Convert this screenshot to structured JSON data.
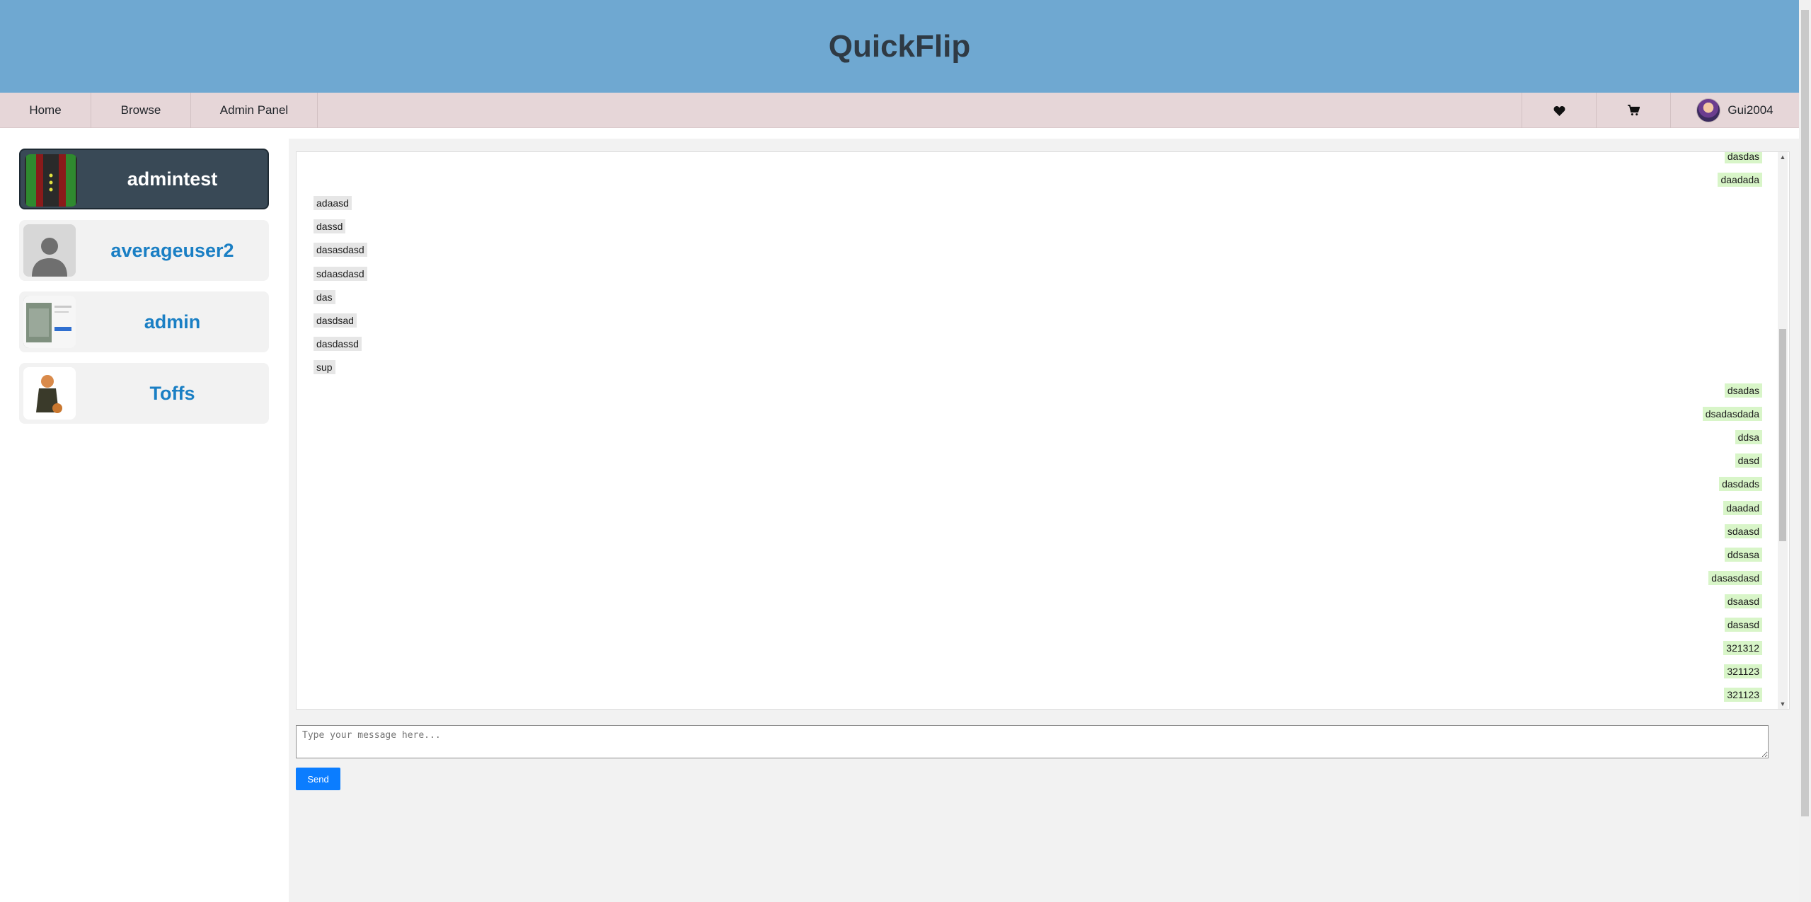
{
  "app": {
    "title": "QuickFlip"
  },
  "nav": {
    "home": "Home",
    "browse": "Browse",
    "admin_panel": "Admin Panel",
    "user_name": "Gui2004"
  },
  "contacts": [
    {
      "name": "admintest",
      "active": true
    },
    {
      "name": "averageuser2",
      "active": false
    },
    {
      "name": "admin",
      "active": false
    },
    {
      "name": "Toffs",
      "active": false
    }
  ],
  "messages": [
    {
      "text": "dasdas",
      "side": "sent"
    },
    {
      "text": "daadada",
      "side": "sent"
    },
    {
      "text": "adaasd",
      "side": "received"
    },
    {
      "text": "dassd",
      "side": "received"
    },
    {
      "text": "dasasdasd",
      "side": "received"
    },
    {
      "text": "sdaasdasd",
      "side": "received"
    },
    {
      "text": "das",
      "side": "received"
    },
    {
      "text": "dasdsad",
      "side": "received"
    },
    {
      "text": "dasdassd",
      "side": "received"
    },
    {
      "text": "sup",
      "side": "received"
    },
    {
      "text": "dsadas",
      "side": "sent"
    },
    {
      "text": "dsadasdada",
      "side": "sent"
    },
    {
      "text": "ddsa",
      "side": "sent"
    },
    {
      "text": "dasd",
      "side": "sent"
    },
    {
      "text": "dasdads",
      "side": "sent"
    },
    {
      "text": "daadad",
      "side": "sent"
    },
    {
      "text": "sdaasd",
      "side": "sent"
    },
    {
      "text": "ddsasa",
      "side": "sent"
    },
    {
      "text": "dasasdasd",
      "side": "sent"
    },
    {
      "text": "dsaasd",
      "side": "sent"
    },
    {
      "text": "dasasd",
      "side": "sent"
    },
    {
      "text": "321312",
      "side": "sent"
    },
    {
      "text": "321123",
      "side": "sent"
    },
    {
      "text": "321123",
      "side": "sent"
    }
  ],
  "composer": {
    "placeholder": "Type your message here...",
    "send_label": "Send"
  },
  "colors": {
    "header": "#6fa8d1",
    "nav": "#e6d6d8",
    "accent": "#1a7fc4",
    "send_button": "#0b7dff",
    "sent_bubble": "#d8f5c8",
    "received_bubble": "#e6e6e6"
  },
  "icons": {
    "wishlist": "heart-icon",
    "cart": "cart-icon"
  }
}
